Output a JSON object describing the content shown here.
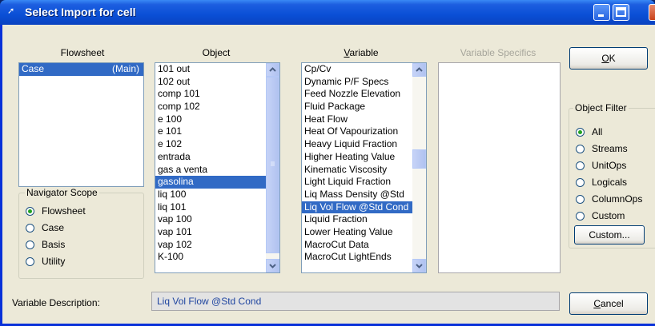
{
  "window": {
    "title": "Select Import for cell",
    "app_icon": "arrow-icon"
  },
  "headers": {
    "flowsheet": "Flowsheet",
    "object": "Object",
    "variable_prefix": "",
    "variable_ul": "V",
    "variable_rest": "ariable",
    "variable_specifics": "Variable Specifics"
  },
  "flowsheet_list": {
    "items": [
      {
        "name": "Case",
        "tag": "(Main)",
        "selected": true
      }
    ]
  },
  "object_list": {
    "items": [
      "101 out",
      "102 out",
      "comp 101",
      "comp 102",
      "e 100",
      "e 101",
      "e 102",
      "entrada",
      "gas a venta",
      "gasolina",
      "liq 100",
      "liq 101",
      "vap 100",
      "vap 101",
      "vap 102",
      "K-100"
    ],
    "selected": "gasolina"
  },
  "variable_list": {
    "items": [
      "Cp/Cv",
      "Dynamic P/F Specs",
      "Feed Nozzle Elevation",
      "Fluid Package",
      "Heat Flow",
      "Heat Of Vapourization",
      "Heavy Liquid Fraction",
      "Higher Heating Value",
      "Kinematic Viscosity",
      "Light Liquid Fraction",
      "Liq Mass Density @Std",
      "Liq Vol Flow @Std Cond",
      "Liquid Fraction",
      "Lower Heating Value",
      "MacroCut Data",
      "MacroCut LightEnds"
    ],
    "selected": "Liq Vol Flow @Std Cond"
  },
  "navigator_scope": {
    "title": "Navigator Scope",
    "options": [
      "Flowsheet",
      "Case",
      "Basis",
      "Utility"
    ],
    "selected": "Flowsheet"
  },
  "object_filter": {
    "title": "Object Filter",
    "options": [
      "All",
      "Streams",
      "UnitOps",
      "Logicals",
      "ColumnOps",
      "Custom"
    ],
    "selected": "All",
    "custom_button": "Custom..."
  },
  "buttons": {
    "ok_ul": "O",
    "ok_rest": "K",
    "cancel_ul": "C",
    "cancel_rest": "ancel"
  },
  "description": {
    "label": "Variable Description:",
    "value": "Liq Vol Flow @Std Cond"
  },
  "colors": {
    "titlebar": "#0a4fd6",
    "selection": "#316ac5",
    "dialog_bg": "#ece9d8"
  }
}
